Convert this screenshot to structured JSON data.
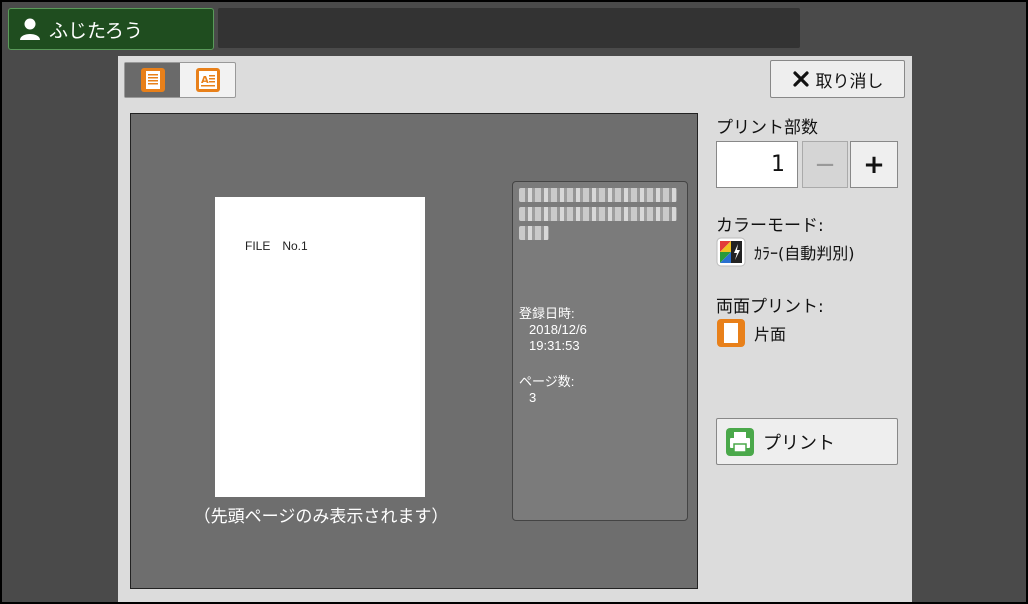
{
  "header": {
    "user_name": "ふじたろう",
    "user_icon": "user-icon"
  },
  "toolbar": {
    "cancel_label": "取り消し"
  },
  "preview": {
    "page_text": "FILE　No.1",
    "caption": "（先頭ページのみ表示されます）",
    "info": {
      "registered_label": "登録日時:",
      "registered_date": "2018/12/6",
      "registered_time": "19:31:53",
      "pages_label": "ページ数:",
      "pages_value": "3"
    }
  },
  "settings": {
    "copies_label": "プリント部数",
    "copies_value": "1",
    "minus_label": "−",
    "plus_label": "+",
    "color_mode_label": "カラーモード:",
    "color_mode_value": "ｶﾗｰ(自動判別)",
    "duplex_label": "両面プリント:",
    "duplex_value": "片面",
    "print_label": "プリント"
  },
  "colors": {
    "accent_orange": "#e8801a",
    "user_tab_green": "#1f4d1f",
    "print_icon_green": "#4aa84a"
  }
}
